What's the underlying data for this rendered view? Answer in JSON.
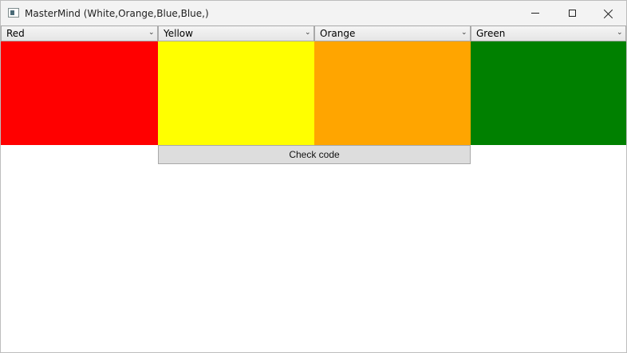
{
  "window": {
    "title": "MasterMind (White,Orange,Blue,Blue,)",
    "controls": {
      "minimize": "minimize-icon",
      "maximize": "maximize-icon",
      "close": "close-icon"
    }
  },
  "guess": {
    "selections": [
      {
        "label": "Red",
        "color": "#ff0000"
      },
      {
        "label": "Yellow",
        "color": "#ffff00"
      },
      {
        "label": "Orange",
        "color": "#ffa500"
      },
      {
        "label": "Green",
        "color": "#008000"
      }
    ],
    "check_button_label": "Check code"
  }
}
